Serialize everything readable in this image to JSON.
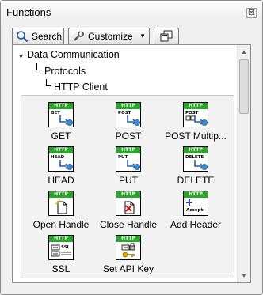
{
  "window": {
    "title": "Functions",
    "close_glyph": "⊠"
  },
  "toolbar": {
    "search_label": "Search",
    "customize_label": "Customize",
    "customize_arrow": "▼"
  },
  "tree": {
    "caret": "▼",
    "root": "Data Communication",
    "child": "Protocols",
    "grandchild": "HTTP Client"
  },
  "palette": {
    "header_text": "HTTP",
    "items": [
      {
        "label": "GET",
        "glyph": "GET",
        "icon": "get-icon"
      },
      {
        "label": "POST",
        "glyph": "POST",
        "icon": "post-icon"
      },
      {
        "label": "POST Multip...",
        "glyph": "POST",
        "icon": "post-multipart-icon"
      },
      {
        "label": "HEAD",
        "glyph": "HEAD",
        "icon": "head-icon"
      },
      {
        "label": "PUT",
        "glyph": "PUT",
        "icon": "put-icon"
      },
      {
        "label": "DELETE",
        "glyph": "DELETE",
        "icon": "delete-icon"
      },
      {
        "label": "Open Handle",
        "glyph": "",
        "icon": "open-handle-icon"
      },
      {
        "label": "Close Handle",
        "glyph": "",
        "icon": "close-handle-icon"
      },
      {
        "label": "Add Header",
        "glyph": "Accept:",
        "icon": "add-header-icon"
      },
      {
        "label": "SSL",
        "glyph": "SSL",
        "icon": "ssl-icon"
      },
      {
        "label": "Set API Key",
        "glyph": "",
        "icon": "set-api-key-icon"
      }
    ]
  },
  "scrollbar": {
    "up_glyph": "▲",
    "down_glyph": "▼"
  },
  "colors": {
    "http_header": "#2aa52a",
    "arrow_blue": "#1f5fbf",
    "globe_blue": "#3a8fd0"
  }
}
